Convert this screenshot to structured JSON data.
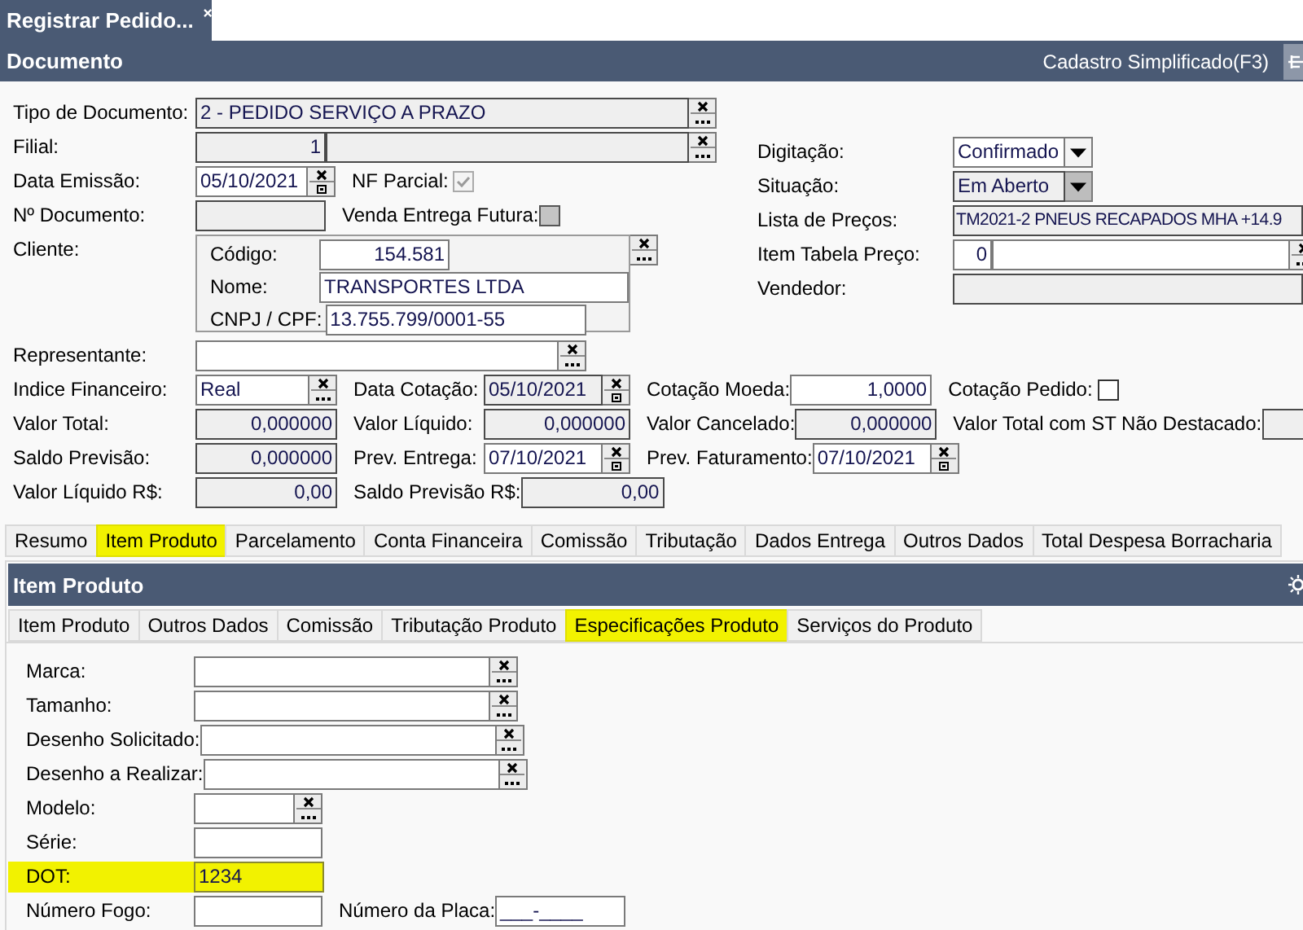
{
  "window_tab": {
    "title": "Registrar Pedido..."
  },
  "header": {
    "title": "Documento",
    "action": "Cadastro Simplificado(F3)"
  },
  "doc_left": [
    {
      "items": [
        {
          "kind": "label",
          "text": "Tipo de Documento:"
        },
        {
          "kind": "lookup",
          "value": "2 - PEDIDO SERVIÇO A PRAZO",
          "disabled": true,
          "numeric": false
        }
      ]
    },
    {
      "items": [
        {
          "kind": "label",
          "text": "Filial:"
        },
        {
          "kind": "input",
          "value": "1",
          "disabled": true,
          "numeric": true
        },
        {
          "kind": "lookup",
          "disabled": true
        }
      ]
    },
    {
      "items": [
        {
          "kind": "label",
          "text": "Data Emissão:"
        },
        {
          "kind": "date",
          "value": "05/10/2021",
          "disabled": false,
          "numeric": false
        },
        {
          "kind": "label",
          "text": "NF Parcial:"
        },
        {
          "kind": "checkbox",
          "checked": true,
          "disabled": true
        }
      ]
    },
    {
      "items": [
        {
          "kind": "label",
          "text": "Nº Documento:"
        },
        {
          "kind": "input",
          "disabled": true
        },
        {
          "kind": "label",
          "text": "Venda Entrega Futura:"
        },
        {
          "kind": "checkbox",
          "checked": false,
          "disabled": true
        }
      ]
    },
    {
      "items": [
        {
          "kind": "label",
          "text": "Cliente:"
        },
        {
          "kind": "client",
          "rows": [
            {
              "label": "Código:",
              "value": "154.581",
              "numeric": true
            },
            {
              "label": "Nome:",
              "value": "TRANSPORTES LTDA",
              "numeric": false
            },
            {
              "label": "CNPJ / CPF:",
              "value": "13.755.799/0001-55",
              "numeric": false
            }
          ]
        },
        {
          "kind": "button"
        }
      ]
    }
  ],
  "doc_right": [
    {
      "items": [
        {
          "kind": "label",
          "text": "Digitação:"
        },
        {
          "kind": "select",
          "value": "Confirmado",
          "disabled": false
        }
      ]
    },
    {
      "items": [
        {
          "kind": "label",
          "text": "Situação:"
        },
        {
          "kind": "select",
          "value": "Em Aberto",
          "disabled": true
        }
      ]
    },
    {
      "items": [
        {
          "kind": "label",
          "text": "Lista de Preços:"
        },
        {
          "kind": "input",
          "value": "TM2021-2 PNEUS RECAPADOS MHA +14.9",
          "disabled": true,
          "numeric": false
        }
      ]
    },
    {
      "items": [
        {
          "kind": "label",
          "text": "Item Tabela Preço:"
        },
        {
          "kind": "input",
          "value": "0",
          "disabled": false,
          "numeric": true
        },
        {
          "kind": "lookup",
          "disabled": false
        }
      ]
    },
    {
      "items": [
        {
          "kind": "label",
          "text": "Vendedor:"
        },
        {
          "kind": "input",
          "disabled": true
        }
      ]
    }
  ],
  "doc_bottom": [
    {
      "items": [
        {
          "kind": "label",
          "text": "Representante:"
        },
        {
          "kind": "lookup",
          "disabled": false
        }
      ]
    },
    {
      "items": [
        {
          "kind": "label",
          "text": "Indice Financeiro:"
        },
        {
          "kind": "lookup",
          "value": "Real",
          "disabled": false,
          "numeric": false
        },
        {
          "kind": "label",
          "text": "Data Cotação:"
        },
        {
          "kind": "date",
          "value": "05/10/2021",
          "disabled": true,
          "numeric": false
        },
        {
          "kind": "label",
          "text": "Cotação Moeda:"
        },
        {
          "kind": "input",
          "value": "1,0000",
          "disabled": false,
          "numeric": true
        },
        {
          "kind": "label",
          "text": "Cotação Pedido:"
        },
        {
          "kind": "checkbox",
          "checked": false,
          "disabled": false
        }
      ]
    },
    {
      "items": [
        {
          "kind": "label",
          "text": "Valor Total:"
        },
        {
          "kind": "input",
          "value": "0,000000",
          "disabled": true,
          "numeric": true
        },
        {
          "kind": "label",
          "text": "Valor Líquido:"
        },
        {
          "kind": "input",
          "value": "0,000000",
          "disabled": true,
          "numeric": true
        },
        {
          "kind": "label",
          "text": "Valor Cancelado:"
        },
        {
          "kind": "input",
          "value": "0,000000",
          "disabled": true,
          "numeric": true
        },
        {
          "kind": "label",
          "text": "Valor Total com ST Não Destacado:"
        },
        {
          "kind": "input",
          "disabled": true
        }
      ]
    },
    {
      "items": [
        {
          "kind": "label",
          "text": "Saldo Previsão:"
        },
        {
          "kind": "input",
          "value": "0,000000",
          "disabled": true,
          "numeric": true
        },
        {
          "kind": "label",
          "text": "Prev. Entrega:"
        },
        {
          "kind": "date",
          "value": "07/10/2021",
          "disabled": false,
          "numeric": false
        },
        {
          "kind": "label",
          "text": "Prev. Faturamento:"
        },
        {
          "kind": "date",
          "value": "07/10/2021",
          "disabled": false,
          "numeric": false
        }
      ]
    },
    {
      "items": [
        {
          "kind": "label",
          "text": "Valor Líquido R$:"
        },
        {
          "kind": "input",
          "value": "0,00",
          "disabled": true,
          "numeric": true
        },
        {
          "kind": "label",
          "text": "Saldo Previsão R$:"
        },
        {
          "kind": "input",
          "value": "0,00",
          "disabled": true,
          "numeric": true
        }
      ]
    }
  ],
  "main_tabs": [
    {
      "label": "Resumo",
      "selected": false
    },
    {
      "label": "Item Produto",
      "selected": true
    },
    {
      "label": "Parcelamento",
      "selected": false
    },
    {
      "label": "Conta Financeira",
      "selected": false
    },
    {
      "label": "Comissão",
      "selected": false
    },
    {
      "label": "Tributação",
      "selected": false
    },
    {
      "label": "Dados Entrega",
      "selected": false
    },
    {
      "label": "Outros Dados",
      "selected": false
    },
    {
      "label": "Total Despesa Borracharia",
      "selected": false
    }
  ],
  "item_panel": {
    "title": "Item Produto",
    "sub_tabs": [
      {
        "label": "Item Produto",
        "selected": false
      },
      {
        "label": "Outros Dados",
        "selected": false
      },
      {
        "label": "Comissão",
        "selected": false
      },
      {
        "label": "Tributação Produto",
        "selected": false
      },
      {
        "label": "Especificações Produto",
        "selected": true
      },
      {
        "label": "Serviços do Produto",
        "selected": false
      }
    ],
    "rows": [
      {
        "highlighted": false,
        "items": [
          {
            "kind": "label",
            "text": "Marca:"
          },
          {
            "kind": "lookup",
            "disabled": false
          }
        ]
      },
      {
        "highlighted": false,
        "items": [
          {
            "kind": "label",
            "text": "Tamanho:"
          },
          {
            "kind": "lookup",
            "disabled": false
          }
        ]
      },
      {
        "highlighted": false,
        "items": [
          {
            "kind": "label",
            "text": "Desenho Solicitado:"
          },
          {
            "kind": "lookup",
            "disabled": false
          }
        ]
      },
      {
        "highlighted": false,
        "items": [
          {
            "kind": "label",
            "text": "Desenho a Realizar:"
          },
          {
            "kind": "lookup",
            "disabled": false
          }
        ]
      },
      {
        "highlighted": false,
        "items": [
          {
            "kind": "label",
            "text": "Modelo:"
          },
          {
            "kind": "lookup",
            "disabled": false
          }
        ]
      },
      {
        "highlighted": false,
        "items": [
          {
            "kind": "label",
            "text": "Série:"
          },
          {
            "kind": "input",
            "disabled": false
          }
        ]
      },
      {
        "highlighted": true,
        "items": [
          {
            "kind": "label",
            "text": "DOT:"
          },
          {
            "kind": "input",
            "value": "1234",
            "disabled": false,
            "numeric": false
          }
        ]
      },
      {
        "highlighted": false,
        "items": [
          {
            "kind": "label",
            "text": "Número Fogo:"
          },
          {
            "kind": "input",
            "disabled": false
          },
          {
            "kind": "label",
            "text": "Número da Placa:"
          },
          {
            "kind": "input",
            "value": "___-____",
            "disabled": false
          }
        ]
      }
    ]
  }
}
